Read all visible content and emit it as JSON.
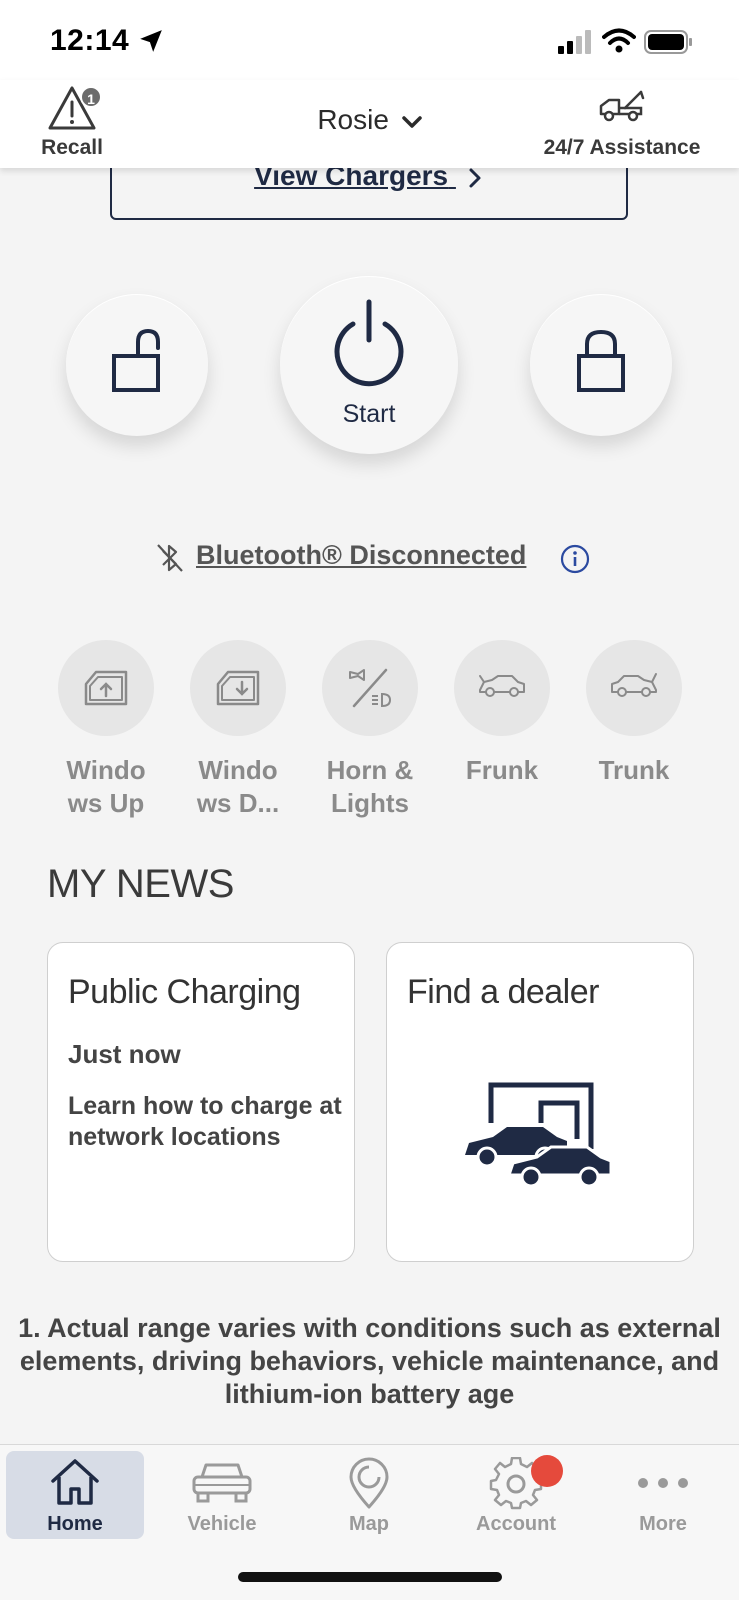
{
  "status_bar": {
    "time": "12:14",
    "icons": [
      "location-arrow-icon",
      "cellular-signal-icon",
      "wifi-icon",
      "battery-icon"
    ]
  },
  "header": {
    "recall_label": "Recall",
    "recall_badge": "1",
    "vehicle_name": "Rosie",
    "assistance_label": "24/7 Assistance"
  },
  "chargers": {
    "link_label": "View Chargers"
  },
  "remote": {
    "start_label": "Start",
    "icons": [
      "unlock-icon",
      "power-icon",
      "lock-icon"
    ]
  },
  "bluetooth": {
    "status_text": "Bluetooth® Disconnected"
  },
  "quick_actions": [
    {
      "label": "Windo ws Up",
      "icon": "window-up-icon"
    },
    {
      "label": "Windo ws D...",
      "icon": "window-down-icon"
    },
    {
      "label": "Horn & Lights",
      "icon": "horn-lights-icon"
    },
    {
      "label": "Frunk",
      "icon": "frunk-icon"
    },
    {
      "label": "Trunk",
      "icon": "trunk-icon"
    }
  ],
  "news": {
    "heading": "MY NEWS",
    "cards": [
      {
        "title": "Public Charging",
        "time": "Just now",
        "description": "Learn how to charge at network locations"
      },
      {
        "title": "Find a dealer",
        "icon": "dealer-cars-icon"
      }
    ]
  },
  "footnote": "1. Actual range varies with conditions such as external elements, driving behaviors, vehicle maintenance, and lithium-ion battery age",
  "bottom_nav": [
    {
      "label": "Home",
      "icon": "home-icon",
      "active": true
    },
    {
      "label": "Vehicle",
      "icon": "car-icon"
    },
    {
      "label": "Map",
      "icon": "map-pin-icon"
    },
    {
      "label": "Account",
      "icon": "gear-icon",
      "notification": true
    },
    {
      "label": "More",
      "icon": "more-dots-icon"
    }
  ],
  "colors": {
    "brand_navy": "#1f2a44",
    "background": "#f4f4f4",
    "notification": "#e54a3c",
    "active_tab_bg": "#d7dce6"
  }
}
